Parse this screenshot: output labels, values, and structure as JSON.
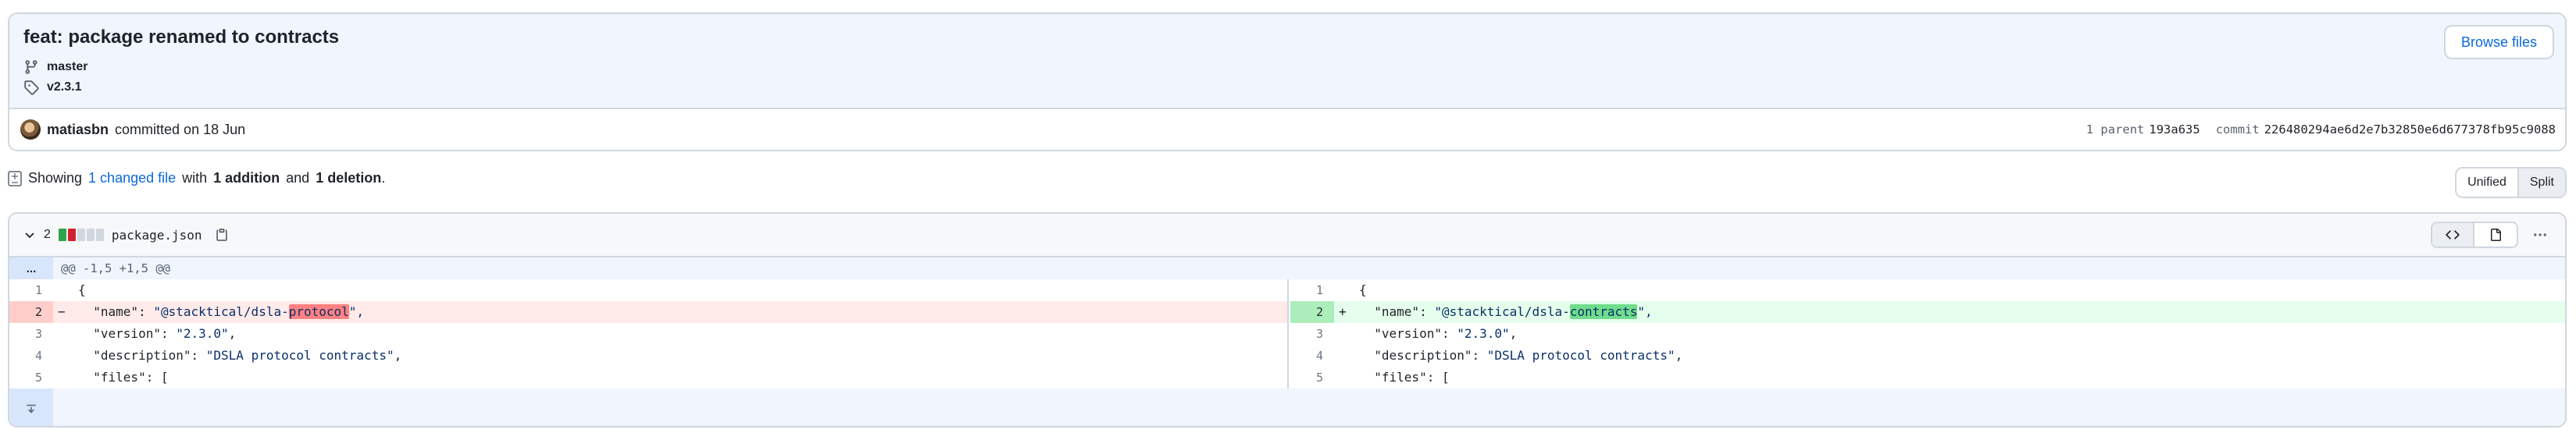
{
  "commit": {
    "title": "feat: package renamed to contracts",
    "branch": "master",
    "tag": "v2.3.1",
    "browse_label": "Browse files",
    "author": "matiasbn",
    "committed_text": "committed on 18 Jun",
    "parent_label": "1 parent",
    "parent_hash": "193a635",
    "commit_label": "commit",
    "commit_hash": "226480294ae6d2e7b32850e6d677378fb95c9088"
  },
  "summary": {
    "prefix": "Showing",
    "changed_link": "1 changed file",
    "with": "with",
    "additions": "1 addition",
    "and": "and",
    "deletions": "1 deletion",
    "end": "."
  },
  "view_toggle": {
    "unified": "Unified",
    "split": "Split"
  },
  "file": {
    "change_count": "2",
    "name": "package.json",
    "hunk_gutter": "...",
    "hunk_header": "@@ -1,5 +1,5 @@",
    "diffstat_colors": [
      "#2da44e",
      "#cf222e",
      "#d0d7de",
      "#d0d7de",
      "#d0d7de"
    ]
  },
  "left_lines": [
    {
      "num": "1",
      "sign": "",
      "type": "ctx",
      "pre": "{",
      "str": "",
      "hl": "",
      "post": ""
    },
    {
      "num": "2",
      "sign": "−",
      "type": "del",
      "pre": "  \"name\": ",
      "str": "\"@stacktical/dsla-",
      "hl": "protocol",
      "post": "\","
    },
    {
      "num": "3",
      "sign": "",
      "type": "ctx",
      "pre": "  \"version\": ",
      "str": "\"2.3.0\"",
      "hl": "",
      "post": ","
    },
    {
      "num": "4",
      "sign": "",
      "type": "ctx",
      "pre": "  \"description\": ",
      "str": "\"DSLA protocol contracts\"",
      "hl": "",
      "post": ","
    },
    {
      "num": "5",
      "sign": "",
      "type": "ctx",
      "pre": "  \"files\": [",
      "str": "",
      "hl": "",
      "post": ""
    }
  ],
  "right_lines": [
    {
      "num": "1",
      "sign": "",
      "type": "ctx",
      "pre": "{",
      "str": "",
      "hl": "",
      "post": ""
    },
    {
      "num": "2",
      "sign": "+",
      "type": "add",
      "pre": "  \"name\": ",
      "str": "\"@stacktical/dsla-",
      "hl": "contracts",
      "post": "\","
    },
    {
      "num": "3",
      "sign": "",
      "type": "ctx",
      "pre": "  \"version\": ",
      "str": "\"2.3.0\"",
      "hl": "",
      "post": ","
    },
    {
      "num": "4",
      "sign": "",
      "type": "ctx",
      "pre": "  \"description\": ",
      "str": "\"DSLA protocol contracts\"",
      "hl": "",
      "post": ","
    },
    {
      "num": "5",
      "sign": "",
      "type": "ctx",
      "pre": "  \"files\": [",
      "str": "",
      "hl": "",
      "post": ""
    }
  ],
  "icons": {
    "branch": "git-branch-icon",
    "tag": "tag-icon",
    "file_diff": "file-diff-icon",
    "chevron": "chevron-down-icon",
    "copy": "copy-icon",
    "code": "code-icon",
    "file": "file-icon",
    "kebab": "kebab-horizontal-icon",
    "expand": "unfold-down-icon"
  }
}
